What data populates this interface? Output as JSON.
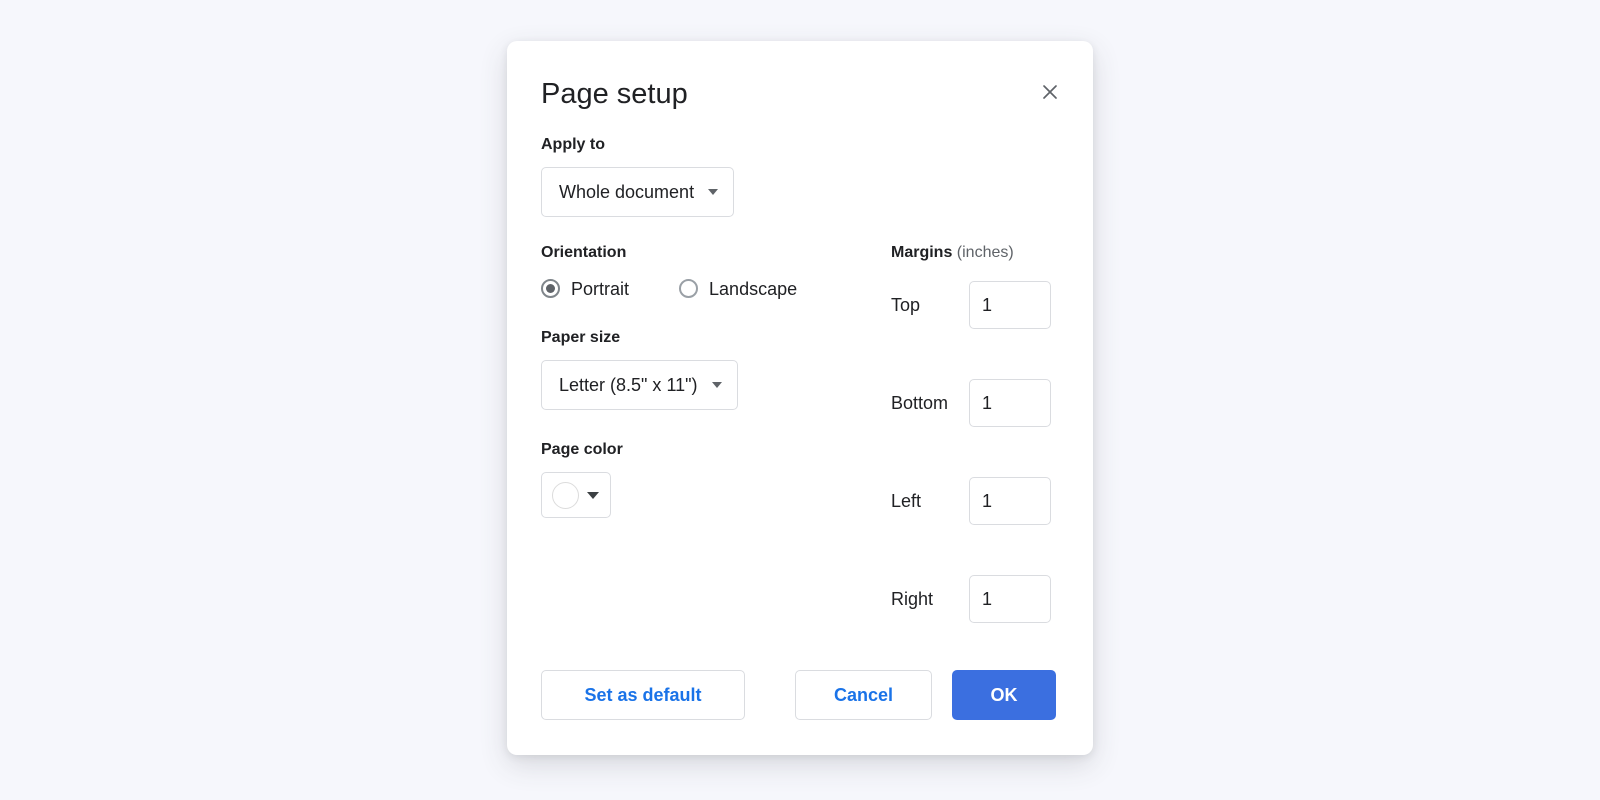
{
  "dialog": {
    "title": "Page setup",
    "close_icon": "close-icon"
  },
  "apply_to": {
    "label": "Apply to",
    "selected": "Whole document",
    "options": [
      "Whole document"
    ]
  },
  "orientation": {
    "label": "Orientation",
    "selected": "Portrait",
    "options": [
      {
        "label": "Portrait",
        "checked": true
      },
      {
        "label": "Landscape",
        "checked": false
      }
    ]
  },
  "paper_size": {
    "label": "Paper size",
    "selected": "Letter (8.5\" x 11\")",
    "options": [
      "Letter (8.5\" x 11\")"
    ]
  },
  "page_color": {
    "label": "Page color",
    "selected_color": "#ffffff"
  },
  "margins": {
    "title_bold": "Margins",
    "title_unit": "(inches)",
    "fields": [
      {
        "label": "Top",
        "value": "1"
      },
      {
        "label": "Bottom",
        "value": "1"
      },
      {
        "label": "Left",
        "value": "1"
      },
      {
        "label": "Right",
        "value": "1"
      }
    ]
  },
  "footer": {
    "set_as_default": "Set as default",
    "cancel": "Cancel",
    "ok": "OK"
  },
  "colors": {
    "accent_blue": "#1a73e8",
    "primary_button": "#3b6fe0",
    "page_background": "#f6f7fc",
    "border": "#dadce0",
    "text": "#202124",
    "muted_text": "#5f6368"
  }
}
